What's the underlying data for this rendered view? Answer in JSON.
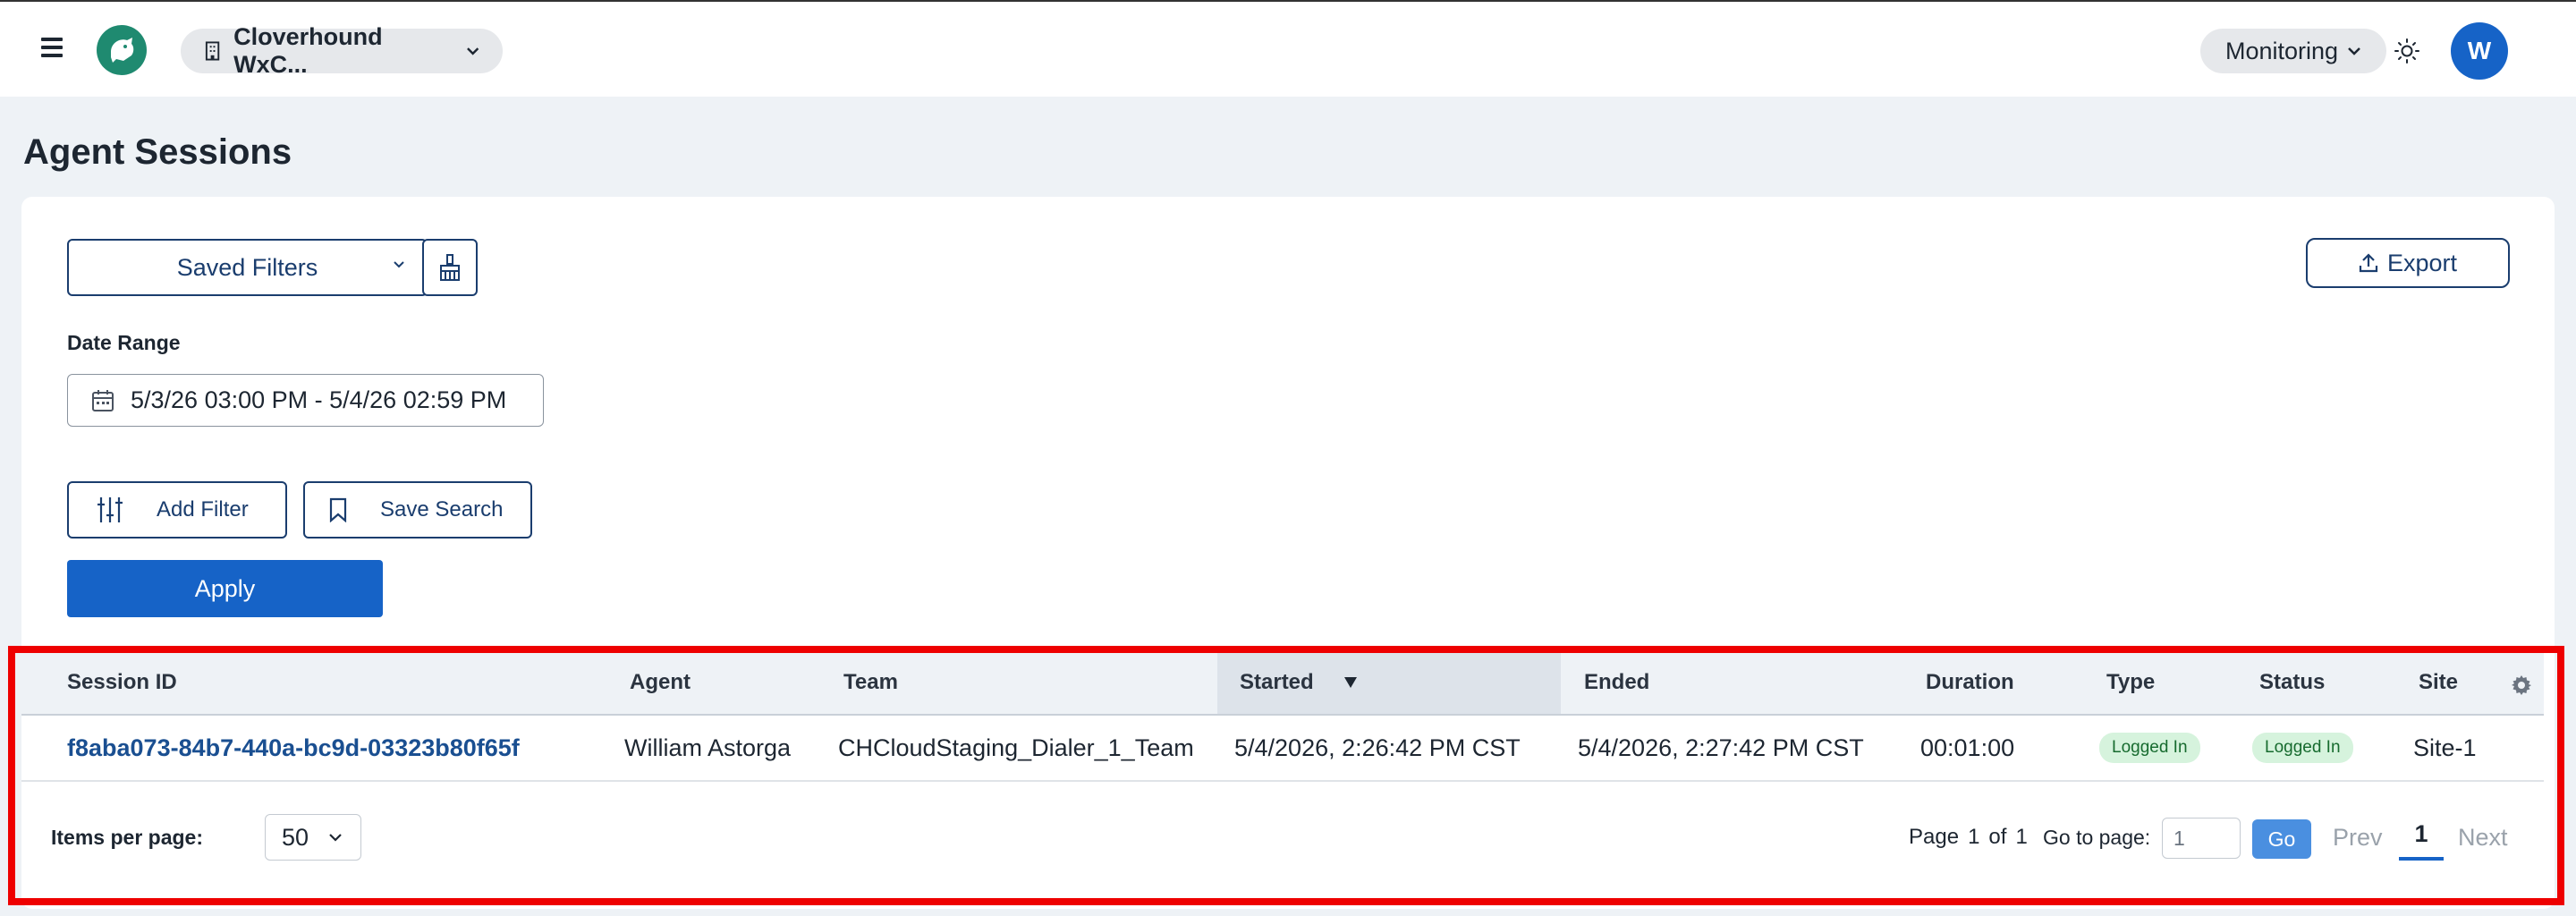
{
  "header": {
    "org_name": "Cloverhound WxC...",
    "monitoring_label": "Monitoring",
    "avatar_initial": "W"
  },
  "page_title": "Agent Sessions",
  "filters": {
    "saved_filters_label": "Saved Filters",
    "export_label": "Export",
    "date_range_label": "Date Range",
    "date_range_value": "5/3/26 03:00 PM - 5/4/26 02:59 PM",
    "add_filter_label": "Add Filter",
    "save_search_label": "Save Search",
    "apply_label": "Apply"
  },
  "table": {
    "columns": [
      "Session ID",
      "Agent",
      "Team",
      "Started",
      "Ended",
      "Duration",
      "Type",
      "Status",
      "Site"
    ],
    "sorted_column": "Started",
    "sort_direction": "descending",
    "rows": [
      {
        "session_id": "f8aba073-84b7-440a-bc9d-03323b80f65f",
        "agent": "William Astorga",
        "team": "CHCloudStaging_Dialer_1_Team",
        "started": "5/4/2026, 2:26:42 PM CST",
        "ended": "5/4/2026, 2:27:42 PM CST",
        "duration": "00:01:00",
        "type": "Logged In",
        "status": "Logged In",
        "site": "Site-1"
      }
    ]
  },
  "pagination": {
    "items_per_page_label": "Items per page:",
    "items_per_page_value": "50",
    "page_label": "Page",
    "current_page": "1",
    "of_label": "of",
    "total_pages": "1",
    "goto_label": "Go to page:",
    "goto_value": "1",
    "go_label": "Go",
    "prev_label": "Prev",
    "page_button": "1",
    "next_label": "Next"
  },
  "colors": {
    "primary": "#1663c7",
    "brand": "#1f8a70",
    "badge_bg": "#d6f3dd",
    "highlight": "#ee0000"
  }
}
